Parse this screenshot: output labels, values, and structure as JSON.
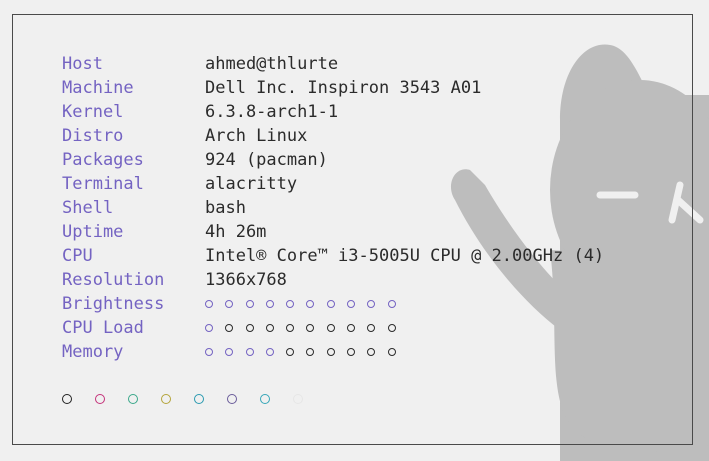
{
  "sysinfo": {
    "rows": [
      {
        "key": "Host",
        "value": "ahmed@thlurte"
      },
      {
        "key": "Machine",
        "value": "Dell Inc. Inspiron 3543 A01"
      },
      {
        "key": "Kernel",
        "value": "6.3.8-arch1-1"
      },
      {
        "key": "Distro",
        "value": "Arch Linux"
      },
      {
        "key": "Packages",
        "value": "924 (pacman)"
      },
      {
        "key": "Terminal",
        "value": "alacritty"
      },
      {
        "key": "Shell",
        "value": "bash"
      },
      {
        "key": "Uptime",
        "value": "4h 26m"
      },
      {
        "key": "CPU",
        "value": "Intel® Core™ i3-5005U CPU @ 2.00GHz (4)"
      },
      {
        "key": "Resolution",
        "value": "1366x768"
      }
    ],
    "bars": [
      {
        "key": "Brightness",
        "filled": 10,
        "total": 10
      },
      {
        "key": "CPU Load",
        "filled": 1,
        "total": 10
      },
      {
        "key": "Memory",
        "filled": 4,
        "total": 10
      }
    ]
  },
  "palette": [
    "#222222",
    "#c4327a",
    "#3aa88a",
    "#b4a43a",
    "#2a9ab0",
    "#6a5c9a",
    "#36a6b8",
    "#e6e6e6"
  ],
  "colors": {
    "key": "#7463c2",
    "value": "#2b2b2b",
    "wallpaper_cat": "#bdbdbd"
  }
}
